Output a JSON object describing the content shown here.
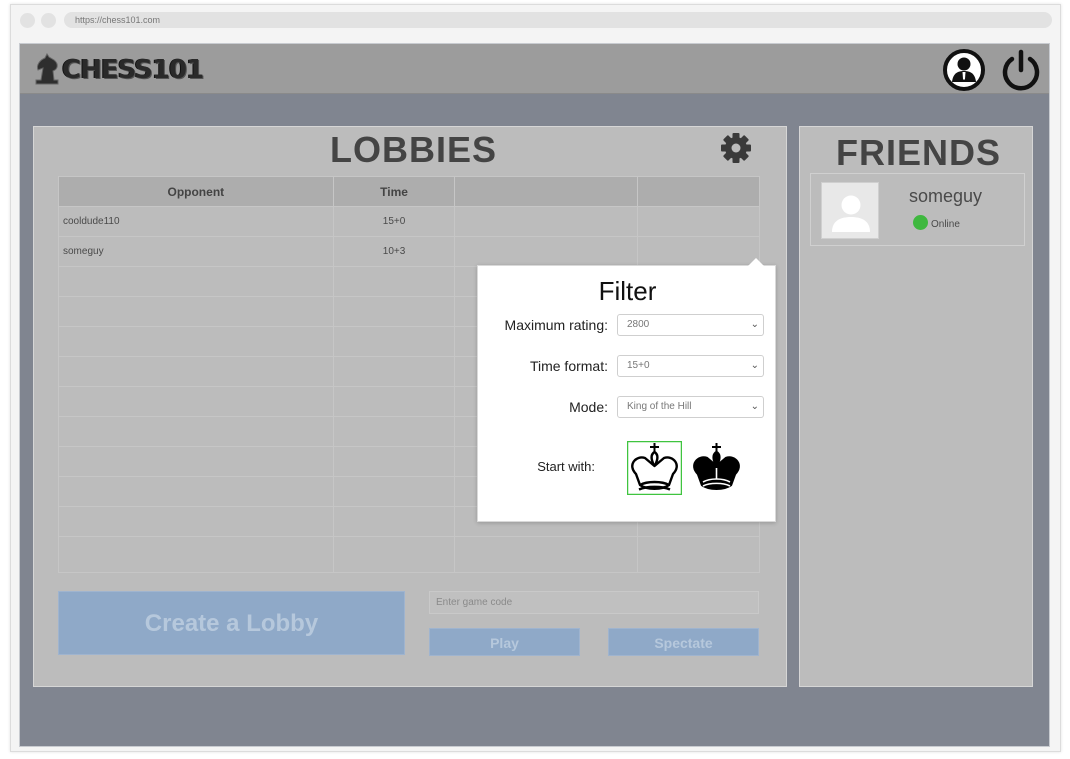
{
  "browser": {
    "url": "https://chess101.com"
  },
  "header": {
    "logo_text": "CHESS101",
    "icons": [
      "user-profile-icon",
      "power-icon"
    ]
  },
  "lobbies": {
    "title": "LOBBIES",
    "columns": [
      "Opponent",
      "Time",
      "",
      ""
    ],
    "rows": [
      {
        "opponent": "cooldude110",
        "time": "15+0"
      },
      {
        "opponent": "someguy",
        "time": "10+3"
      }
    ],
    "create_label": "Create a Lobby",
    "code_placeholder": "Enter game code",
    "play_label": "Play",
    "spectate_label": "Spectate"
  },
  "friends": {
    "title": "FRIENDS",
    "items": [
      {
        "name": "someguy",
        "status": "Online",
        "status_color": "#3fb83f"
      }
    ]
  },
  "filter": {
    "title": "Filter",
    "max_rating_label": "Maximum rating:",
    "max_rating_value": "2800",
    "time_format_label": "Time format:",
    "time_format_value": "15+0",
    "mode_label": "Mode:",
    "mode_value": "King of the Hill",
    "start_with_label": "Start with:",
    "start_options": [
      "white-king",
      "black-king"
    ],
    "selected_start": "white-king"
  },
  "colors": {
    "accent_button": "#8fa9c8",
    "background": "#808590",
    "panel": "#bcbcbc",
    "online": "#3fb83f",
    "selected_border": "#3fc43f"
  }
}
